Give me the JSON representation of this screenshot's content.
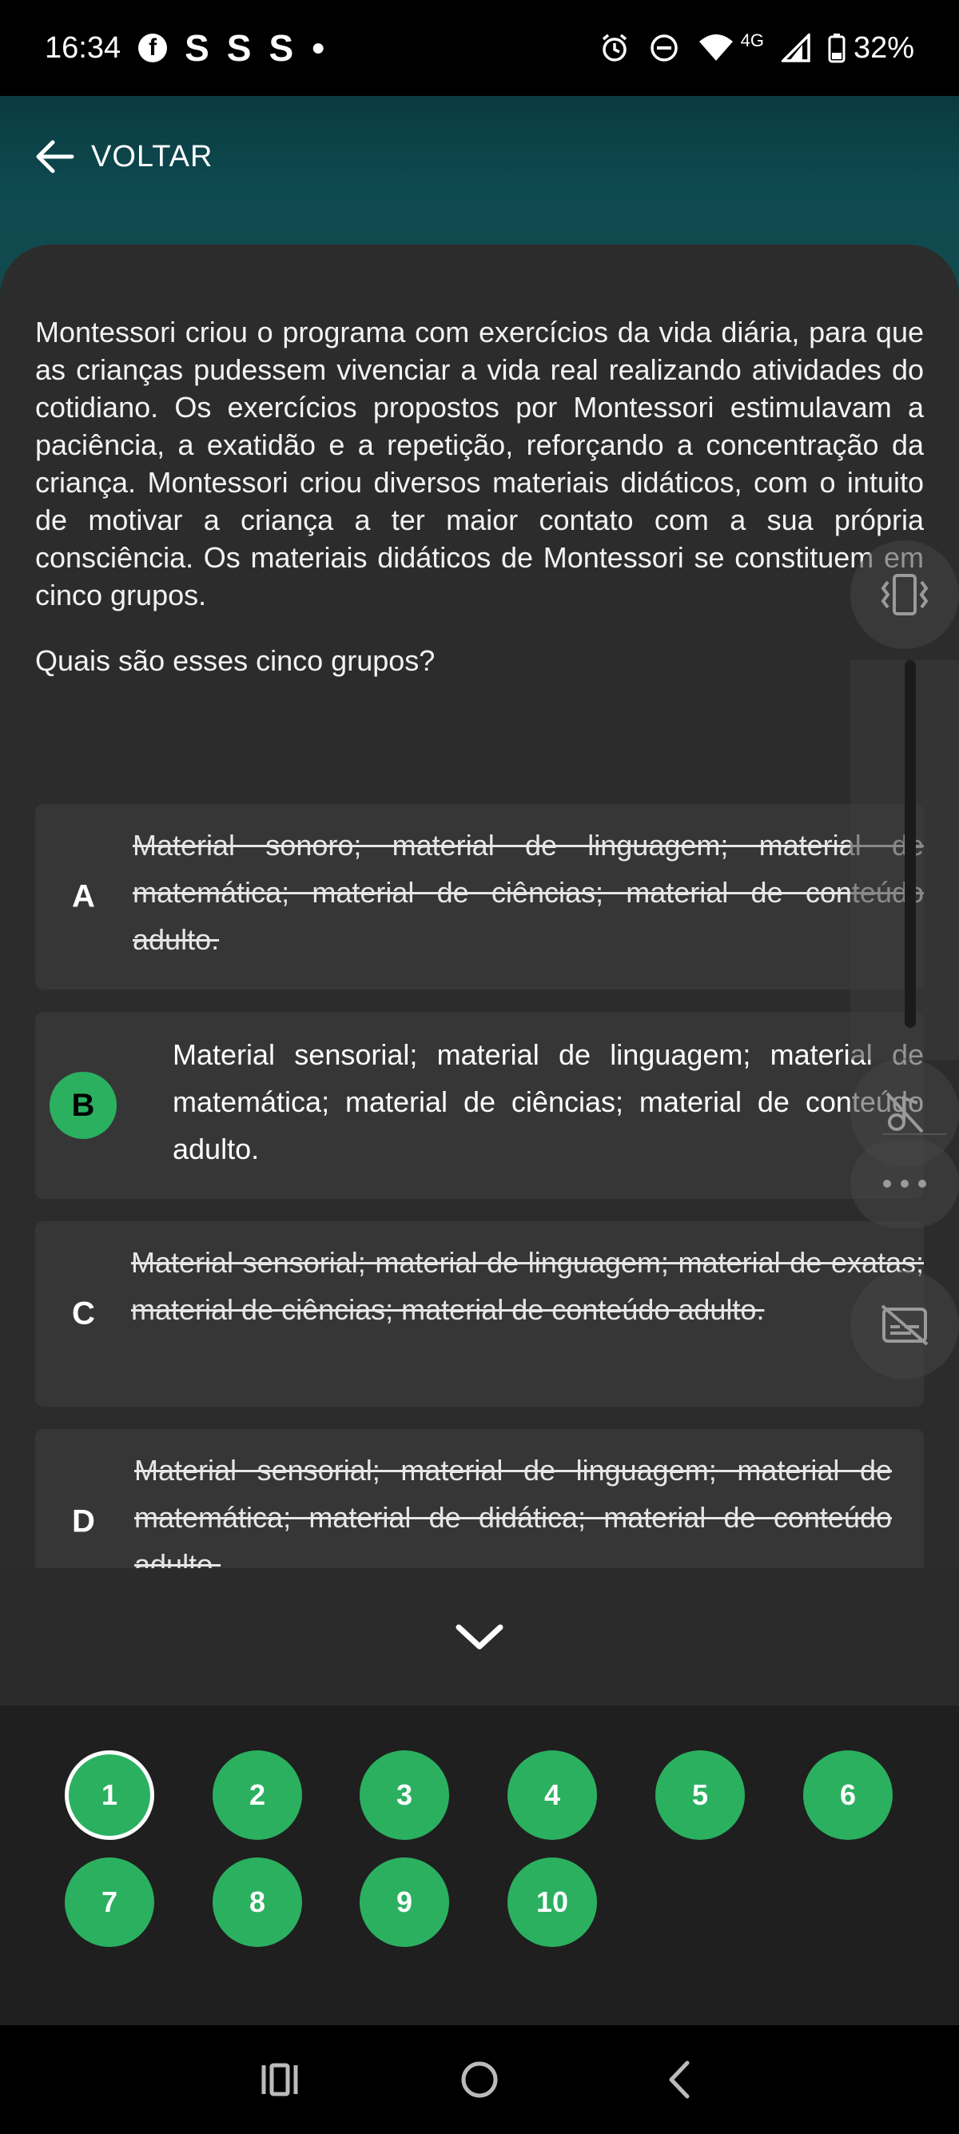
{
  "status_bar": {
    "time": "16:34",
    "apps": [
      "S",
      "S",
      "S"
    ],
    "network": "4G",
    "battery": "32%"
  },
  "header": {
    "back_label": "VOLTAR"
  },
  "question": {
    "text": "Montessori criou o programa com exercícios da vida diária, para que as crianças pudessem vivenciar a vida real realizando atividades do cotidiano. Os exercícios propostos por Montessori estimulavam a paciência, a exatidão e a repetição, reforçando a concentração da criança. Montessori criou diversos materiais didáticos, com o intuito de motivar a criança a ter maior contato com a sua própria  consciência. Os materiais didáticos de Montessori se constituem em cinco grupos.",
    "prompt": "Quais são esses cinco grupos?"
  },
  "options": [
    {
      "letter": "A",
      "text": "Material sonoro; material de linguagem; material de matemática; material de ciências; material de conteúdo adulto.",
      "eliminated": true
    },
    {
      "letter": "B",
      "text": "Material sensorial; material de linguagem; material de matemática; material de ciências; material de conteúdo adulto.",
      "selected": true
    },
    {
      "letter": "C",
      "text": "Material sensorial; material de linguagem; material de exatas; material de ciências; material de conteúdo adulto.",
      "eliminated": true
    },
    {
      "letter": "D",
      "text": "Material sensorial; material de linguagem; material de matemática; material de didática; material de conteúdo adulto.",
      "eliminated": true
    }
  ],
  "navigator": {
    "current": "1",
    "numbers": [
      "1",
      "2",
      "3",
      "4",
      "5",
      "6",
      "7",
      "8",
      "9",
      "10"
    ]
  },
  "colors": {
    "accent": "#2bb060",
    "card": "#2d2c2d",
    "option_bg": "#373637",
    "header_teal": "#0d4a50"
  },
  "icons": [
    "facebook-icon",
    "alarm-icon",
    "dnd-icon",
    "wifi-icon",
    "signal-icon",
    "battery-icon",
    "arrow-left-icon",
    "vibrate-icon",
    "music-off-icon",
    "more-icon",
    "subtitles-off-icon",
    "chevron-down-icon",
    "recents-icon",
    "home-icon",
    "back-nav-icon"
  ]
}
